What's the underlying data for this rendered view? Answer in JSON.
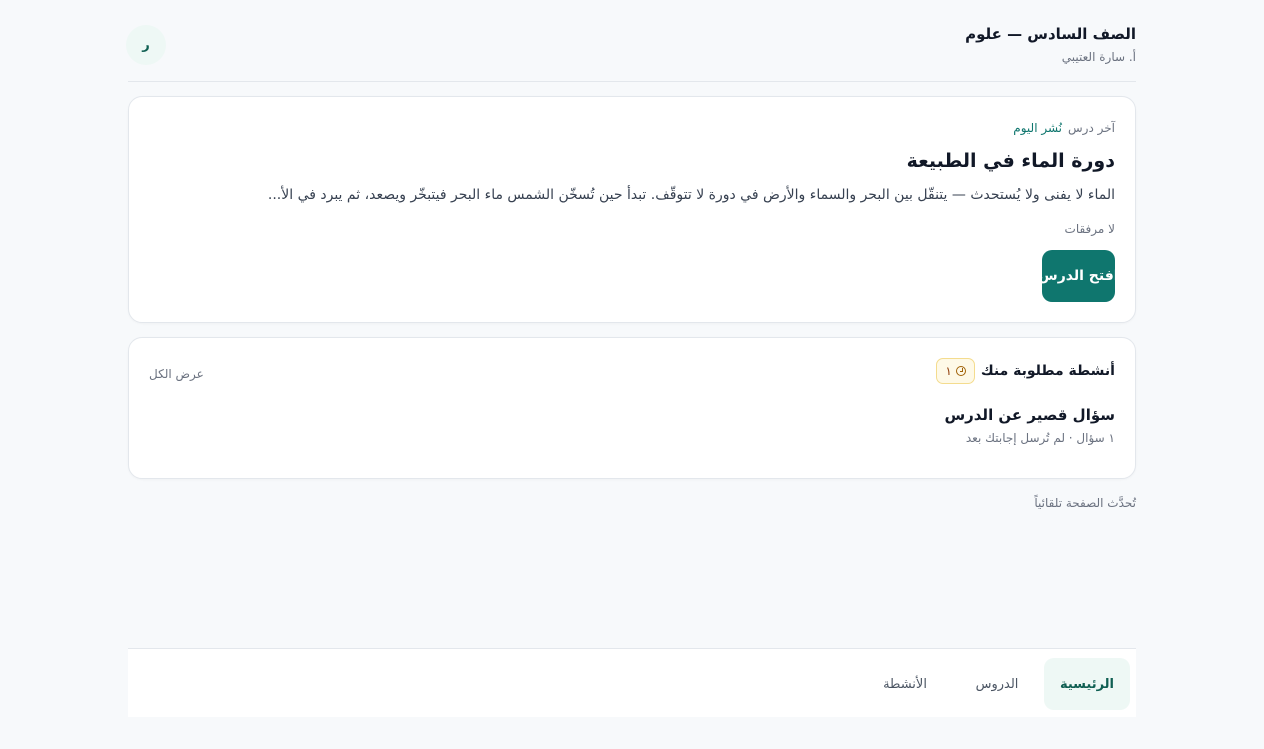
{
  "header": {
    "class_title": "الصف السادس — علوم",
    "teacher": "أ. سارة العتيبي",
    "avatar_initial": "ر"
  },
  "lesson": {
    "label": "آخر درس",
    "published": "نُشر اليوم",
    "title": "دورة الماء في الطبيعة",
    "excerpt": "الماء لا يفنى ولا يُستحدث — يتنقّل بين البحر والسماء والأرض في دورة لا تتوقّف. تبدأ حين تُسخّن الشمس ماء البحر فيتبخّر ويصعد، ثم يبرد في الأ...",
    "attachments": "لا مرفقات",
    "open_button": "افتح الدرس"
  },
  "activities": {
    "title": "أنشطة مطلوبة منك",
    "badge_count": "١",
    "view_all": "عرض الكل",
    "items": [
      {
        "title": "سؤال قصير عن الدرس",
        "meta": "١ سؤال · لم تُرسل إجابتك بعد"
      }
    ]
  },
  "refresh_note": "تُحدَّث الصفحة تلقائياً",
  "nav": {
    "home": "الرئيسية",
    "lessons": "الدروس",
    "activities": "الأنشطة"
  },
  "colors": {
    "accent": "#0f766e",
    "badge_bg": "#fef9e7"
  }
}
